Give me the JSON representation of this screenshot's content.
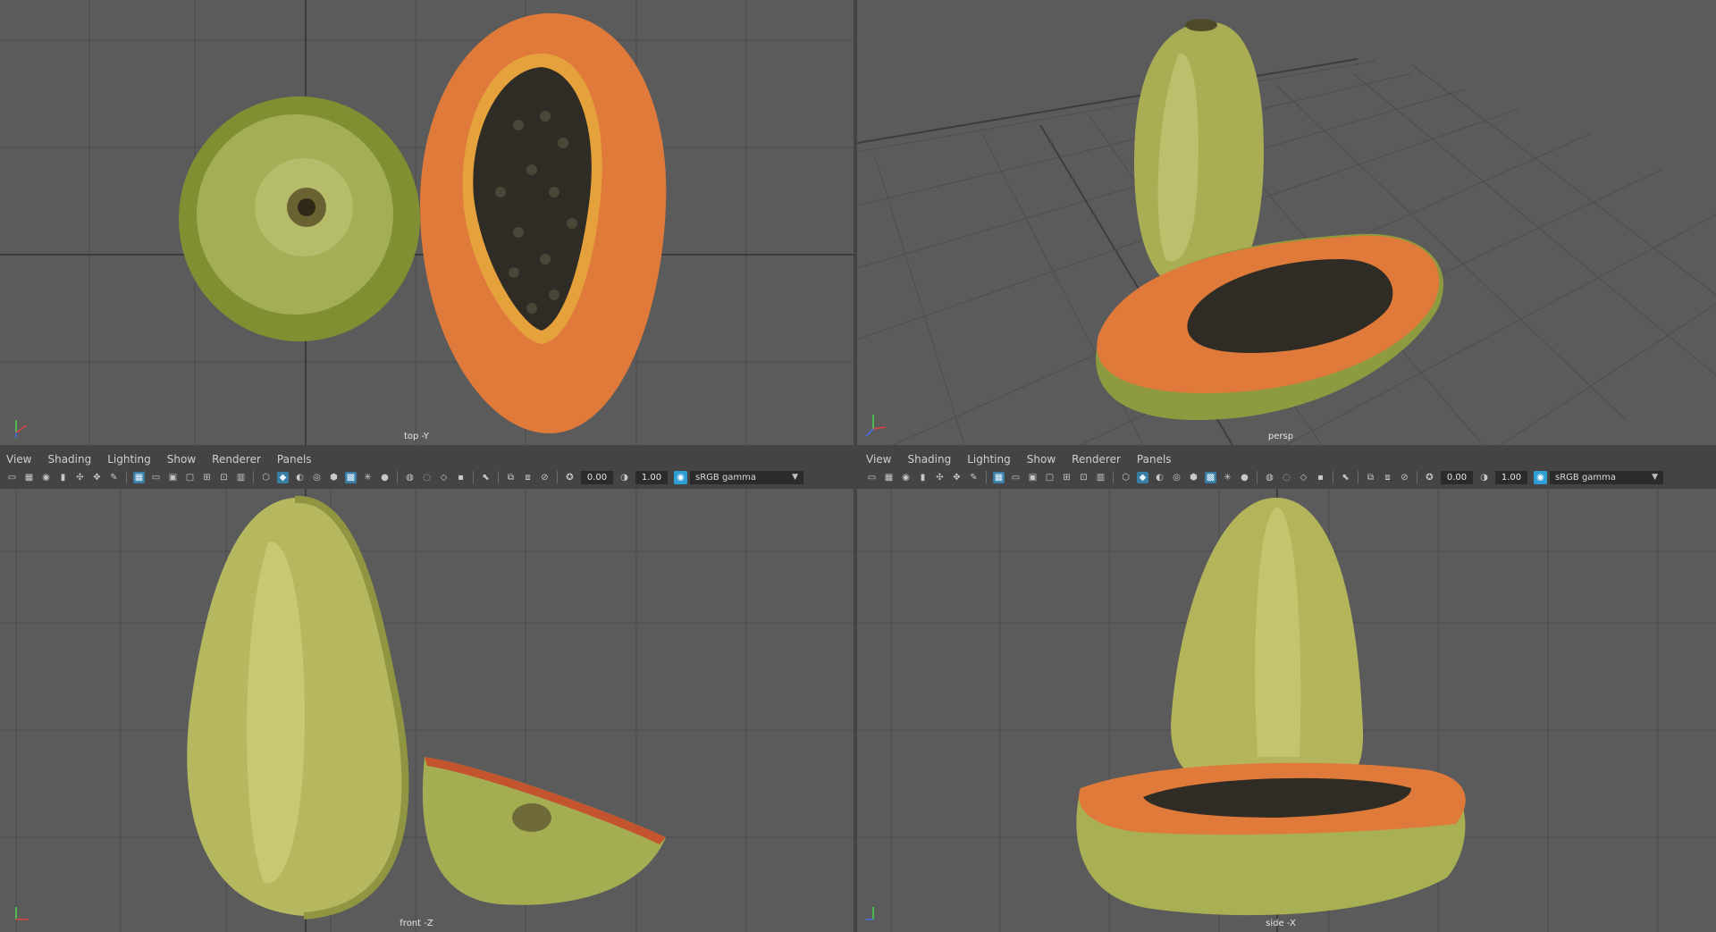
{
  "menu": [
    "View",
    "Shading",
    "Lighting",
    "Show",
    "Renderer",
    "Panels"
  ],
  "toolbar": {
    "exposure": "0.00",
    "gamma": "1.00",
    "colorspace": "sRGB gamma"
  },
  "viewports": {
    "top": "top -Y",
    "persp": "persp",
    "front": "front -Z",
    "side": "side -X"
  },
  "axis": {
    "x": "x",
    "y": "y",
    "z": "z"
  },
  "colors": {
    "viewport_bg": "#5b5b5b",
    "grid": "#4a4a4a",
    "panel": "#444444",
    "accent": "#2e9ed6"
  },
  "icons": [
    "camera-icon",
    "film-icon",
    "bookmark-icon",
    "grid-icon",
    "shaded-icon",
    "wireframe-icon",
    "texture-icon",
    "light-icon",
    "isolate-icon",
    "exposure-icon",
    "gamma-icon",
    "colorspace-icon"
  ]
}
